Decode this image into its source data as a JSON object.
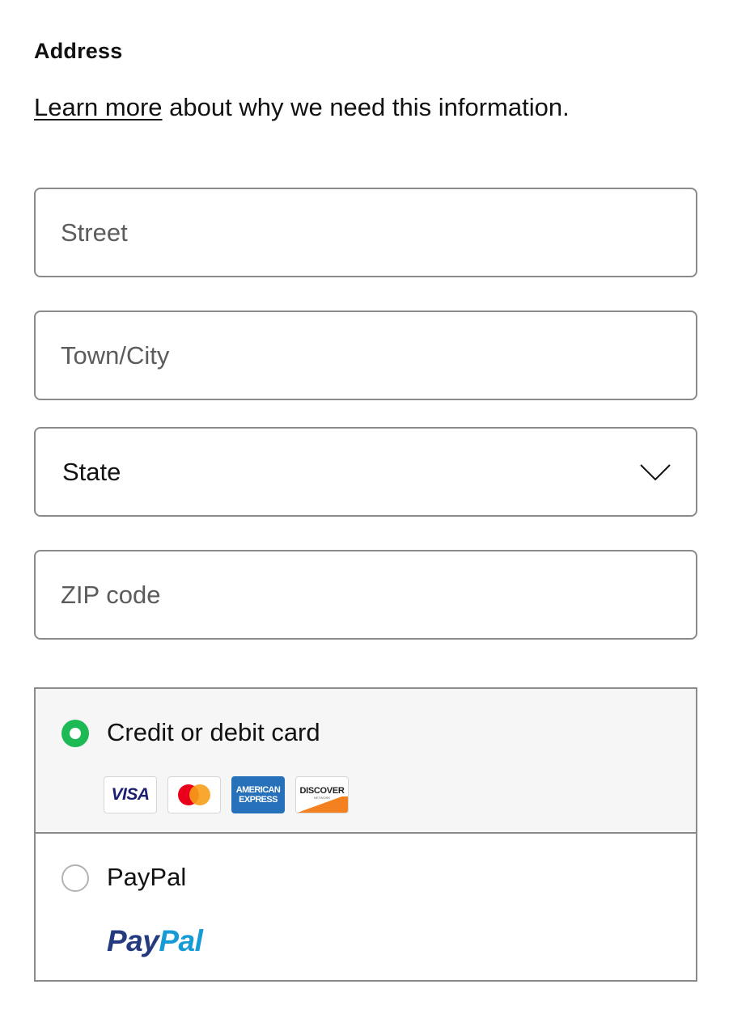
{
  "address": {
    "title": "Address",
    "learn_more_link": "Learn more",
    "learn_more_suffix": " about why we need this information.",
    "street": {
      "placeholder": "Street",
      "value": ""
    },
    "city": {
      "placeholder": "Town/City",
      "value": ""
    },
    "state": {
      "selected": "State"
    },
    "zip": {
      "placeholder": "ZIP code",
      "value": ""
    }
  },
  "payment": {
    "options": [
      {
        "label": "Credit or debit card",
        "selected": true
      },
      {
        "label": "PayPal",
        "selected": false
      }
    ],
    "card_logos": {
      "visa": "VISA",
      "mastercard": "mastercard-logo",
      "amex_line1": "AMERICAN",
      "amex_line2": "EXPRESS",
      "discover": "DISCOVER",
      "discover_network": "NETWORK"
    },
    "paypal_logo": {
      "part1": "Pay",
      "part2": "Pal"
    }
  },
  "colors": {
    "accent_green": "#1db954",
    "border_gray": "#8a8a8a",
    "selected_bg": "#f6f6f6",
    "paypal_dark": "#253b80",
    "paypal_light": "#179bd7"
  }
}
